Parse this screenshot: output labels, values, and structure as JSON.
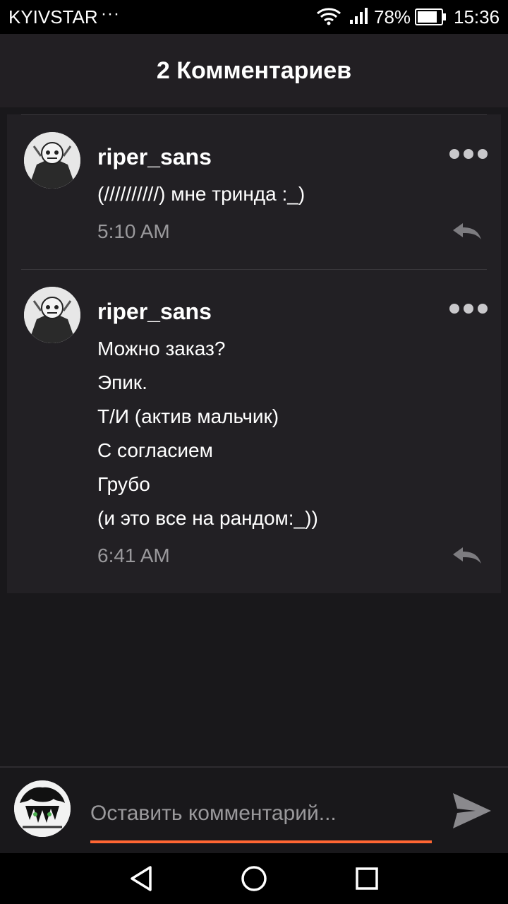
{
  "status_bar": {
    "carrier": "KYIVSTAR",
    "dots": "···",
    "battery_percent": "78%",
    "time": "15:36"
  },
  "header": {
    "title": "2 Комментариев"
  },
  "comments": [
    {
      "username": "riper_sans",
      "lines": [
        "(//////////) мне тринда :_)"
      ],
      "time": "5:10 AM"
    },
    {
      "username": "riper_sans",
      "lines": [
        "Можно заказ?",
        "Эпик.",
        "Т/И (актив мальчик)",
        "С согласием",
        "Грубо",
        "(и это все на рандом:_))"
      ],
      "time": "6:41 AM"
    }
  ],
  "composer": {
    "placeholder": "Оставить комментарий..."
  },
  "colors": {
    "accent": "#ff6633",
    "background": "#19181b",
    "card": "#222024",
    "muted_text": "#9a999c"
  },
  "icons": [
    "wifi-icon",
    "signal-icon",
    "battery-icon",
    "more-icon",
    "reply-icon",
    "send-icon",
    "back-icon",
    "home-icon",
    "recents-icon"
  ]
}
